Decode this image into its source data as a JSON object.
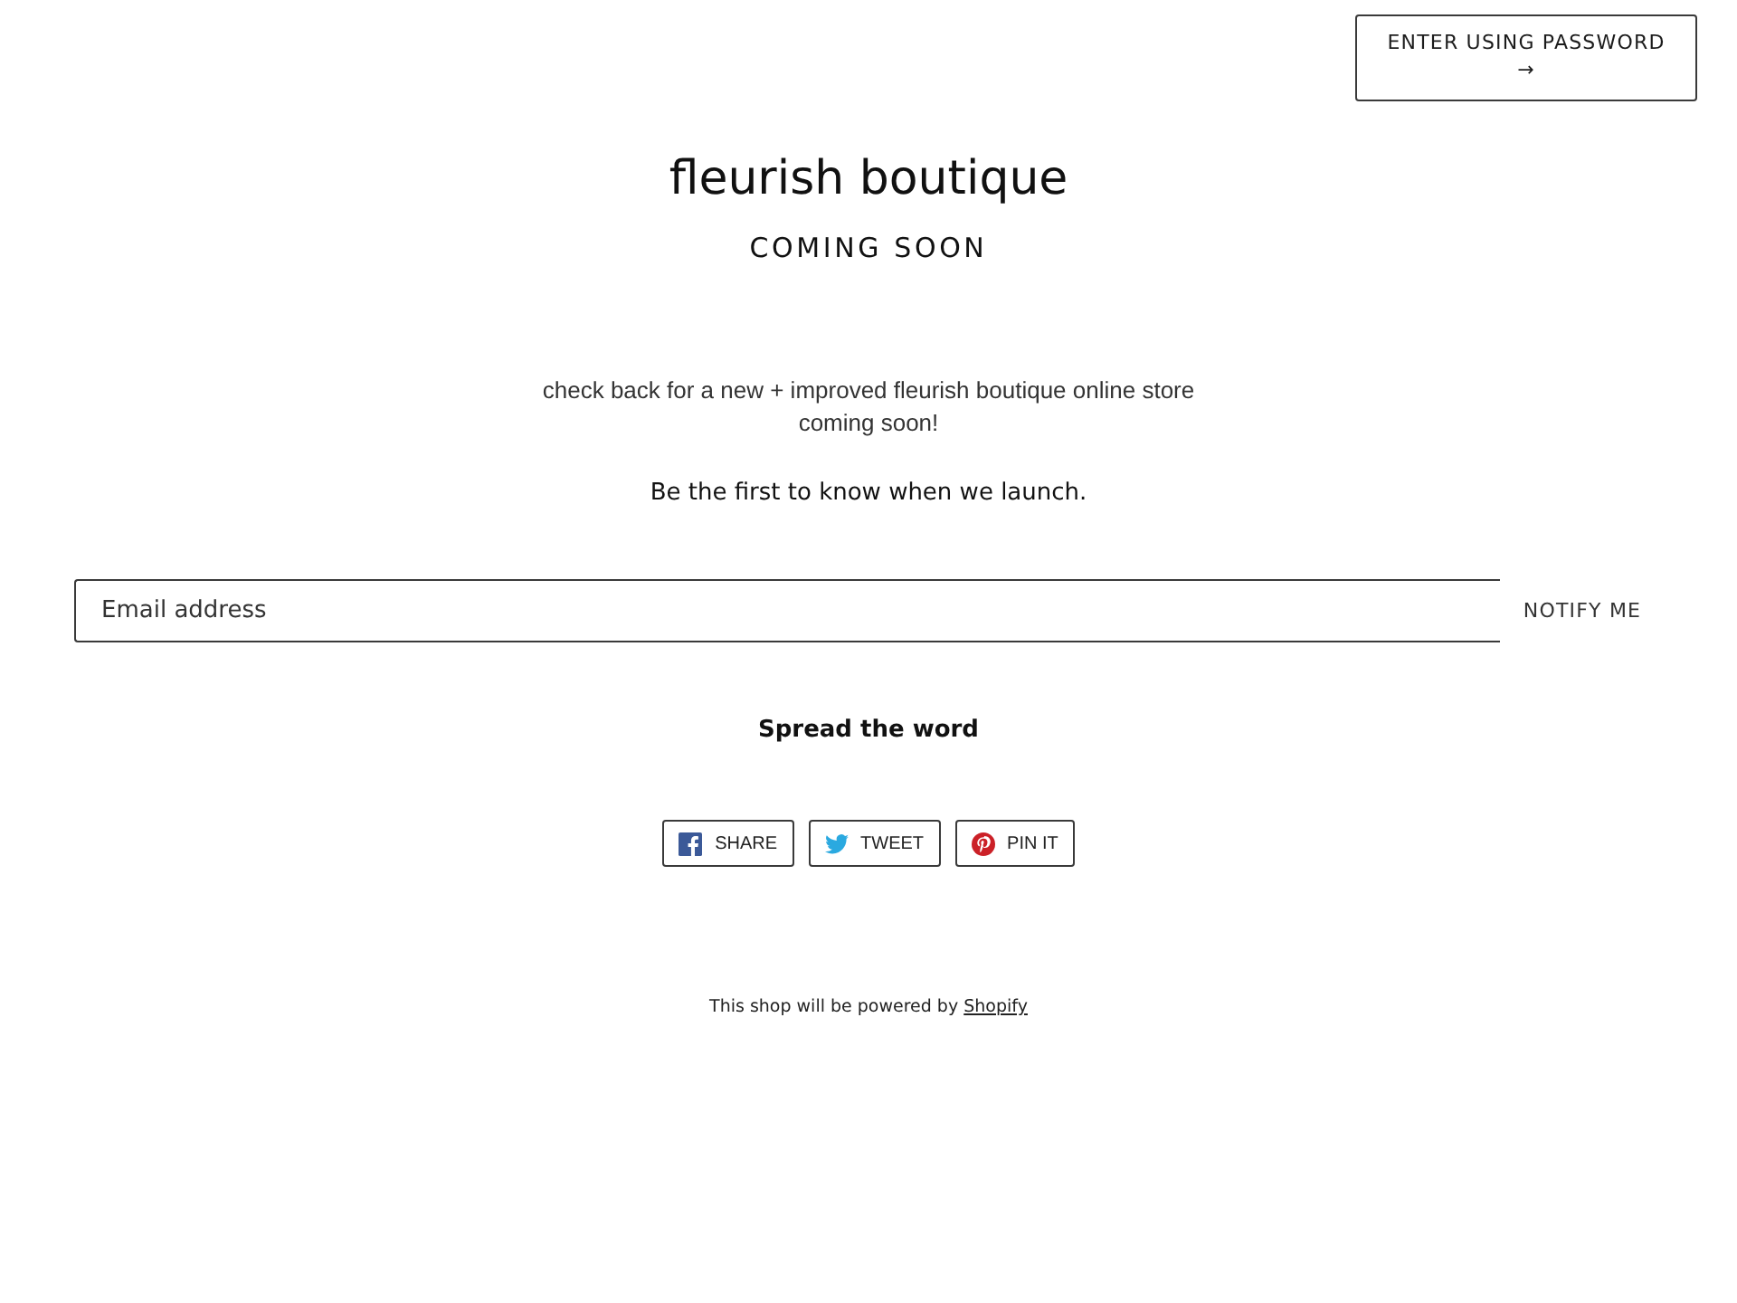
{
  "header": {
    "password_button": {
      "label": "ENTER USING PASSWORD",
      "arrow": "→"
    }
  },
  "store": {
    "title": "fleurish boutique",
    "subtitle": "COMING SOON"
  },
  "intro": {
    "message": "check back for a new + improved fleurish boutique online store coming soon!",
    "call_to_action": "Be the first to know when we launch."
  },
  "signup": {
    "email_field": {
      "placeholder": "Email address"
    },
    "submit_button": "NOTIFY ME"
  },
  "share": {
    "heading": "Spread the word",
    "buttons": [
      {
        "kind": "facebook",
        "label": "SHARE"
      },
      {
        "kind": "twitter",
        "label": "TWEET"
      },
      {
        "kind": "pinterest",
        "label": "PIN IT"
      }
    ]
  },
  "footer": {
    "text": "This shop will be powered by",
    "link": "Shopify"
  }
}
